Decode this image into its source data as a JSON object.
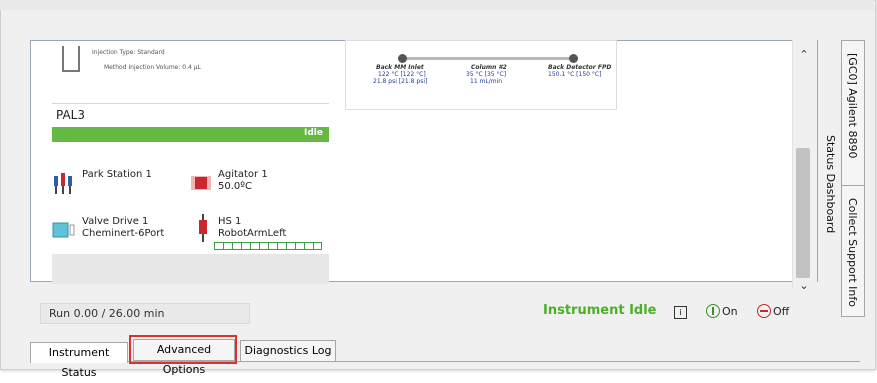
{
  "injection": {
    "type": "Injection Type: Standard",
    "volume": "Method Injection Volume: 0.4 µL"
  },
  "flow": {
    "inlet": {
      "title": "Back MM Inlet",
      "temp": "122 °C [122 °C]",
      "pressure": "21.8 psi [21.8 psi]"
    },
    "column": {
      "title": "Column #2",
      "temp": "35 °C [35 °C]",
      "flow": "11 mL/min"
    },
    "detector": {
      "title": "Back Detector FPD",
      "temp": "150.1 °C [150 °C]"
    }
  },
  "pal3": {
    "name": "PAL3",
    "status": "Idle",
    "modules": [
      {
        "name": "Park Station 1",
        "value": ""
      },
      {
        "name": "Agitator 1",
        "value": "50.0ºC"
      },
      {
        "name": "Valve Drive 1",
        "value": "Cheminert-6Port"
      },
      {
        "name": "HS 1",
        "value": "RobotArmLeft"
      }
    ]
  },
  "status_bar": {
    "run": "Run 0.00 / 26.00 min",
    "instrument_status": "Instrument Idle",
    "info_icon": "i",
    "on_label": "On",
    "off_label": "Off"
  },
  "right_tabs": {
    "agilent": "[GC0] Agilent 8890",
    "dashboard": "Status Dashboard",
    "support": "Collect Support Info"
  },
  "bottom_tabs": [
    "Instrument Status",
    "Advanced Options",
    "Diagnostics Log"
  ],
  "colors": {
    "idle_green": "#64b943",
    "status_green": "#4caf28",
    "highlight_red": "#d9342b",
    "link_blue": "#1f3c9b"
  }
}
